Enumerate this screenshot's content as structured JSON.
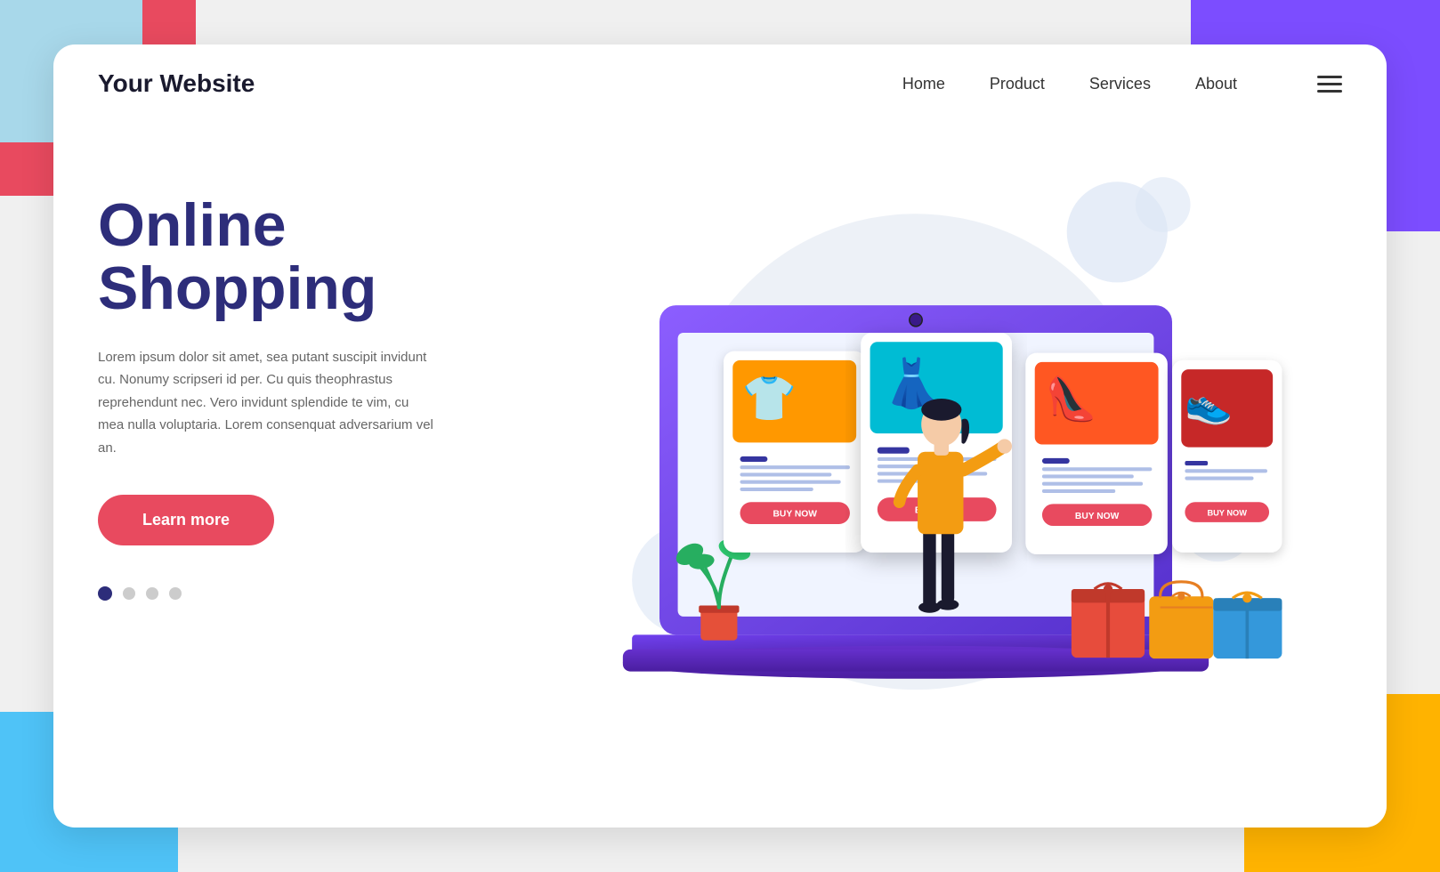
{
  "page": {
    "bg_colors": {
      "corner_tl": "#e84a5f",
      "corner_tl_blue": "#a8d8ea",
      "corner_tr": "#7c4dff",
      "corner_bl": "#4fc3f7",
      "corner_br": "#ffb300"
    }
  },
  "navbar": {
    "logo": "Your Website",
    "links": [
      {
        "label": "Home",
        "id": "home"
      },
      {
        "label": "Product",
        "id": "product"
      },
      {
        "label": "Services",
        "id": "services"
      },
      {
        "label": "About",
        "id": "about"
      }
    ],
    "hamburger_icon": "menu-icon"
  },
  "hero": {
    "title_line1": "Online",
    "title_line2": "Shopping",
    "description": "Lorem ipsum dolor sit amet, sea putant suscipit invidunt cu. Nonumy scripseri id per. Cu quis theophrastus reprehendunt nec. Vero invidunt splendide te vim, cu mea nulla voluptaria. Lorem consenquat adversarium vel an.",
    "cta_button": "Learn more",
    "dots": [
      {
        "active": true
      },
      {
        "active": false
      },
      {
        "active": false
      },
      {
        "active": false
      }
    ]
  },
  "products": [
    {
      "icon": "👕",
      "color": "orange",
      "buy_label": "BUY NOW"
    },
    {
      "icon": "👗",
      "color": "red",
      "buy_label": "BUY NOW",
      "featured": true
    },
    {
      "icon": "👡",
      "color": "cyan",
      "buy_label": "BUY NOW"
    },
    {
      "icon": "👟",
      "color": "dark-red",
      "buy_label": "BUY NOW"
    }
  ]
}
